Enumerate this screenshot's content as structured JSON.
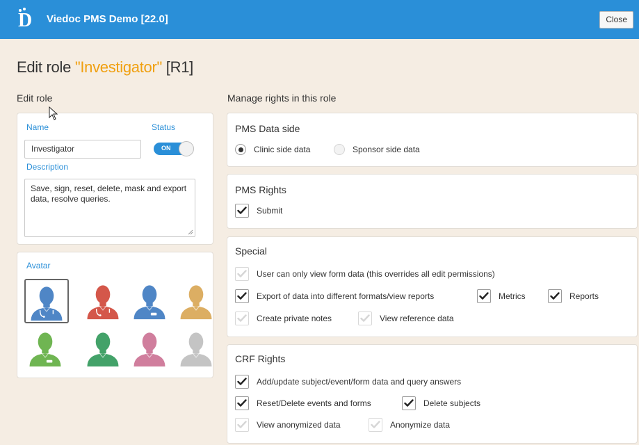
{
  "header": {
    "app_title": "Viedoc PMS Demo [22.0]",
    "close_label": "Close",
    "bar_color": "#2a8fd8"
  },
  "page": {
    "title_prefix": "Edit role ",
    "title_role": "\"Investigator\"",
    "title_suffix": " [R1]",
    "accent_color": "#f0a010"
  },
  "left": {
    "heading": "Edit role",
    "name_label": "Name",
    "status_label": "Status",
    "name_value": "Investigator",
    "toggle_label": "ON",
    "description_label": "Description",
    "description_value": "Save, sign, reset, delete, mask and export data, resolve queries.",
    "avatar_label": "Avatar",
    "avatars": [
      {
        "icon": "doctor-avatar-icon",
        "color": "#4f86c6",
        "selected": true
      },
      {
        "icon": "doctor-avatar-icon",
        "color": "#d4574a",
        "selected": false
      },
      {
        "icon": "nurse-avatar-icon",
        "color": "#4f86c6",
        "selected": false
      },
      {
        "icon": "person-avatar-icon",
        "color": "#dcae63",
        "selected": false
      },
      {
        "icon": "nurse-avatar-icon",
        "color": "#6fb552",
        "selected": false
      },
      {
        "icon": "person-avatar-icon",
        "color": "#43a269",
        "selected": false
      },
      {
        "icon": "person-avatar-icon",
        "color": "#d07e9d",
        "selected": false
      },
      {
        "icon": "person-avatar-icon",
        "color": "#c4c4c4",
        "selected": false
      }
    ]
  },
  "right": {
    "heading": "Manage rights in this role",
    "data_side": {
      "title": "PMS Data side",
      "options": [
        {
          "label": "Clinic side data",
          "selected": true
        },
        {
          "label": "Sponsor side data",
          "selected": false
        }
      ]
    },
    "pms_rights": {
      "title": "PMS Rights",
      "items": [
        {
          "label": "Submit",
          "checked": true
        }
      ]
    },
    "special": {
      "title": "Special",
      "items": [
        {
          "label": "User can only view form data (this overrides all edit permissions)",
          "checked": false
        },
        {
          "label": "Export of data into different formats/view reports",
          "checked": true
        },
        {
          "label": "Metrics",
          "checked": true
        },
        {
          "label": "Reports",
          "checked": true
        },
        {
          "label": "Create private notes",
          "checked": false
        },
        {
          "label": "View reference data",
          "checked": false
        }
      ]
    },
    "crf_rights": {
      "title": "CRF Rights",
      "items": [
        {
          "label": "Add/update subject/event/form data and query answers",
          "checked": true
        },
        {
          "label": "Reset/Delete events and forms",
          "checked": true
        },
        {
          "label": "Delete subjects",
          "checked": true
        },
        {
          "label": "View anonymized data",
          "checked": false
        },
        {
          "label": "Anonymize data",
          "checked": false
        }
      ]
    }
  }
}
